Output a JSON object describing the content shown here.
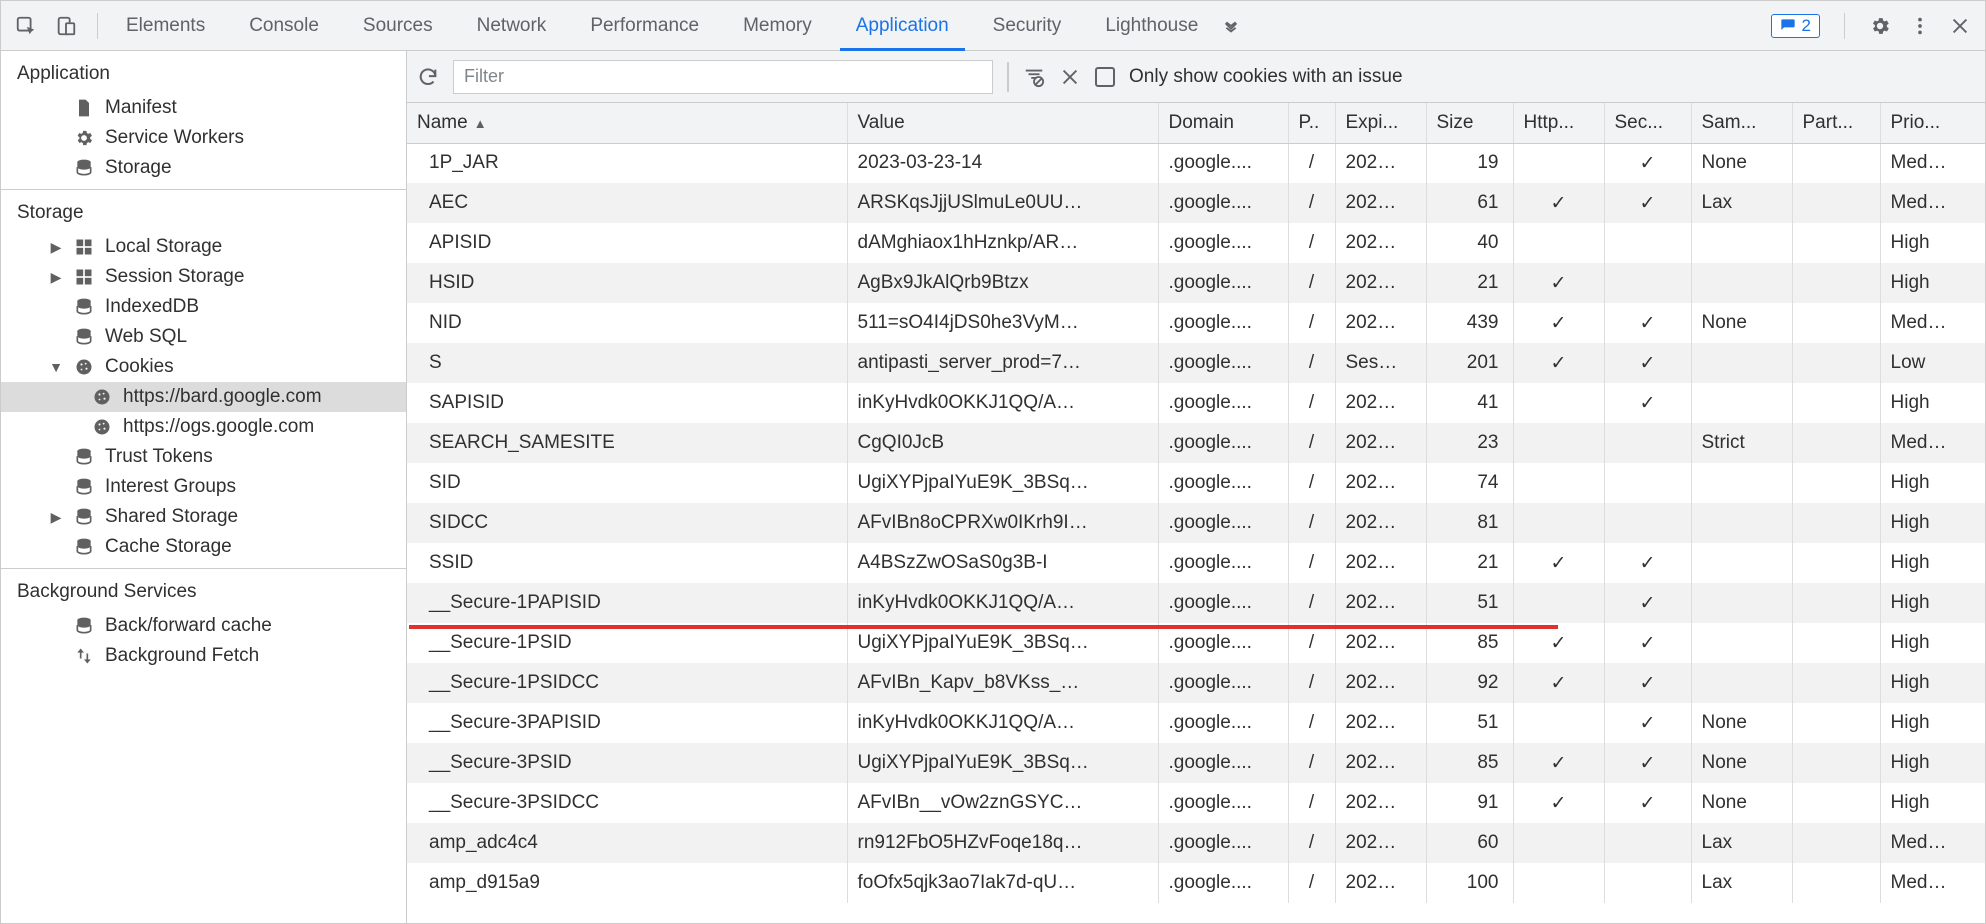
{
  "tabs": {
    "items": [
      "Elements",
      "Console",
      "Sources",
      "Network",
      "Performance",
      "Memory",
      "Application",
      "Security",
      "Lighthouse"
    ],
    "active": "Application",
    "issue_count": "2"
  },
  "sidebar": {
    "groups": [
      {
        "title": "Application",
        "items": [
          {
            "label": "Manifest",
            "icon": "file",
            "indent": 1
          },
          {
            "label": "Service Workers",
            "icon": "gear",
            "indent": 1
          },
          {
            "label": "Storage",
            "icon": "db",
            "indent": 1
          }
        ]
      },
      {
        "title": "Storage",
        "items": [
          {
            "label": "Local Storage",
            "icon": "grid",
            "indent": 1,
            "arrow": "right"
          },
          {
            "label": "Session Storage",
            "icon": "grid",
            "indent": 1,
            "arrow": "right"
          },
          {
            "label": "IndexedDB",
            "icon": "db",
            "indent": 1
          },
          {
            "label": "Web SQL",
            "icon": "db",
            "indent": 1
          },
          {
            "label": "Cookies",
            "icon": "cookie",
            "indent": 1,
            "arrow": "down"
          },
          {
            "label": "https://bard.google.com",
            "icon": "cookie",
            "indent": 2,
            "selected": true
          },
          {
            "label": "https://ogs.google.com",
            "icon": "cookie",
            "indent": 2
          },
          {
            "label": "Trust Tokens",
            "icon": "db",
            "indent": 1
          },
          {
            "label": "Interest Groups",
            "icon": "db",
            "indent": 1
          },
          {
            "label": "Shared Storage",
            "icon": "db",
            "indent": 1,
            "arrow": "right"
          },
          {
            "label": "Cache Storage",
            "icon": "db",
            "indent": 1
          }
        ]
      },
      {
        "title": "Background Services",
        "items": [
          {
            "label": "Back/forward cache",
            "icon": "db",
            "indent": 1
          },
          {
            "label": "Background Fetch",
            "icon": "updown",
            "indent": 1
          }
        ]
      }
    ]
  },
  "toolbar": {
    "filter_placeholder": "Filter",
    "only_issue_label": "Only show cookies with an issue"
  },
  "table": {
    "columns": [
      "Name",
      "Value",
      "Domain",
      "P..",
      "Expi...",
      "Size",
      "Http...",
      "Sec...",
      "Sam...",
      "Part...",
      "Prio..."
    ],
    "rows": [
      {
        "name": "1P_JAR",
        "value": "2023-03-23-14",
        "domain": ".google....",
        "path": "/",
        "expires": "202…",
        "size": "19",
        "httponly": "",
        "secure": "✓",
        "samesite": "None",
        "partition": "",
        "priority": "Med…"
      },
      {
        "name": "AEC",
        "value": "ARSKqsJjjUSlmuLe0UU…",
        "domain": ".google....",
        "path": "/",
        "expires": "202…",
        "size": "61",
        "httponly": "✓",
        "secure": "✓",
        "samesite": "Lax",
        "partition": "",
        "priority": "Med…"
      },
      {
        "name": "APISID",
        "value": "dAMghiaox1hHznkp/AR…",
        "domain": ".google....",
        "path": "/",
        "expires": "202…",
        "size": "40",
        "httponly": "",
        "secure": "",
        "samesite": "",
        "partition": "",
        "priority": "High"
      },
      {
        "name": "HSID",
        "value": "AgBx9JkAlQrb9Btzx",
        "domain": ".google....",
        "path": "/",
        "expires": "202…",
        "size": "21",
        "httponly": "✓",
        "secure": "",
        "samesite": "",
        "partition": "",
        "priority": "High"
      },
      {
        "name": "NID",
        "value": "511=sO4I4jDS0he3VyM…",
        "domain": ".google....",
        "path": "/",
        "expires": "202…",
        "size": "439",
        "httponly": "✓",
        "secure": "✓",
        "samesite": "None",
        "partition": "",
        "priority": "Med…"
      },
      {
        "name": "S",
        "value": "antipasti_server_prod=7…",
        "domain": ".google....",
        "path": "/",
        "expires": "Ses…",
        "size": "201",
        "httponly": "✓",
        "secure": "✓",
        "samesite": "",
        "partition": "",
        "priority": "Low"
      },
      {
        "name": "SAPISID",
        "value": "inKyHvdk0OKKJ1QQ/A…",
        "domain": ".google....",
        "path": "/",
        "expires": "202…",
        "size": "41",
        "httponly": "",
        "secure": "✓",
        "samesite": "",
        "partition": "",
        "priority": "High"
      },
      {
        "name": "SEARCH_SAMESITE",
        "value": "CgQI0JcB",
        "domain": ".google....",
        "path": "/",
        "expires": "202…",
        "size": "23",
        "httponly": "",
        "secure": "",
        "samesite": "Strict",
        "partition": "",
        "priority": "Med…"
      },
      {
        "name": "SID",
        "value": "UgiXYPjpaIYuE9K_3BSq…",
        "domain": ".google....",
        "path": "/",
        "expires": "202…",
        "size": "74",
        "httponly": "",
        "secure": "",
        "samesite": "",
        "partition": "",
        "priority": "High"
      },
      {
        "name": "SIDCC",
        "value": "AFvIBn8oCPRXw0IKrh9I…",
        "domain": ".google....",
        "path": "/",
        "expires": "202…",
        "size": "81",
        "httponly": "",
        "secure": "",
        "samesite": "",
        "partition": "",
        "priority": "High"
      },
      {
        "name": "SSID",
        "value": "A4BSzZwOSaS0g3B-I",
        "domain": ".google....",
        "path": "/",
        "expires": "202…",
        "size": "21",
        "httponly": "✓",
        "secure": "✓",
        "samesite": "",
        "partition": "",
        "priority": "High"
      },
      {
        "name": "__Secure-1PAPISID",
        "value": "inKyHvdk0OKKJ1QQ/A…",
        "domain": ".google....",
        "path": "/",
        "expires": "202…",
        "size": "51",
        "httponly": "",
        "secure": "✓",
        "samesite": "",
        "partition": "",
        "priority": "High"
      },
      {
        "name": "__Secure-1PSID",
        "value": "UgiXYPjpaIYuE9K_3BSq…",
        "domain": ".google....",
        "path": "/",
        "expires": "202…",
        "size": "85",
        "httponly": "✓",
        "secure": "✓",
        "samesite": "",
        "partition": "",
        "priority": "High"
      },
      {
        "name": "__Secure-1PSIDCC",
        "value": "AFvIBn_Kapv_b8VKss_…",
        "domain": ".google....",
        "path": "/",
        "expires": "202…",
        "size": "92",
        "httponly": "✓",
        "secure": "✓",
        "samesite": "",
        "partition": "",
        "priority": "High"
      },
      {
        "name": "__Secure-3PAPISID",
        "value": "inKyHvdk0OKKJ1QQ/A…",
        "domain": ".google....",
        "path": "/",
        "expires": "202…",
        "size": "51",
        "httponly": "",
        "secure": "✓",
        "samesite": "None",
        "partition": "",
        "priority": "High"
      },
      {
        "name": "__Secure-3PSID",
        "value": "UgiXYPjpaIYuE9K_3BSq…",
        "domain": ".google....",
        "path": "/",
        "expires": "202…",
        "size": "85",
        "httponly": "✓",
        "secure": "✓",
        "samesite": "None",
        "partition": "",
        "priority": "High"
      },
      {
        "name": "__Secure-3PSIDCC",
        "value": "AFvIBn__vOw2znGSYC…",
        "domain": ".google....",
        "path": "/",
        "expires": "202…",
        "size": "91",
        "httponly": "✓",
        "secure": "✓",
        "samesite": "None",
        "partition": "",
        "priority": "High"
      },
      {
        "name": "amp_adc4c4",
        "value": "rn912FbO5HZvFoqe18q…",
        "domain": ".google....",
        "path": "/",
        "expires": "202…",
        "size": "60",
        "httponly": "",
        "secure": "",
        "samesite": "Lax",
        "partition": "",
        "priority": "Med…"
      },
      {
        "name": "amp_d915a9",
        "value": "foOfx5qjk3ao7Iak7d-qU…",
        "domain": ".google....",
        "path": "/",
        "expires": "202…",
        "size": "100",
        "httponly": "",
        "secure": "",
        "samesite": "Lax",
        "partition": "",
        "priority": "Med…"
      }
    ]
  }
}
